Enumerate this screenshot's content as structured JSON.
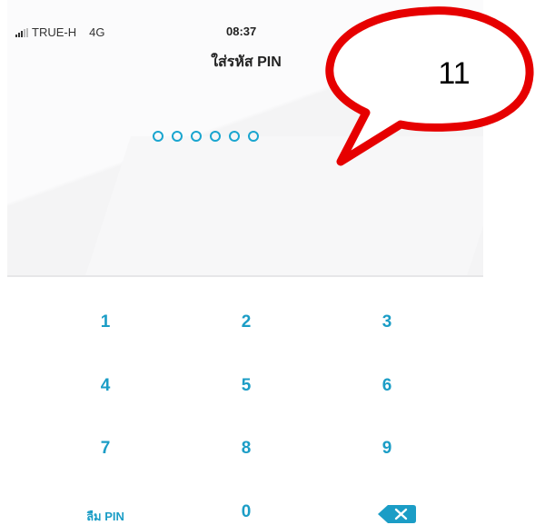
{
  "status_bar": {
    "carrier": "TRUE-H",
    "network": "4G",
    "time": "08:37"
  },
  "screen": {
    "title": "ใส่รหัส PIN",
    "pin_length": 6
  },
  "keypad": {
    "keys": [
      "1",
      "2",
      "3",
      "4",
      "5",
      "6",
      "7",
      "8",
      "9"
    ],
    "forgot_pin": "ลืม PIN",
    "zero": "0",
    "backspace_icon": "backspace-icon"
  },
  "annotation": {
    "label": "11",
    "bubble_color": "#e60000"
  },
  "colors": {
    "accent": "#1b9dc6",
    "pin_dot": "#1aa5cf"
  }
}
